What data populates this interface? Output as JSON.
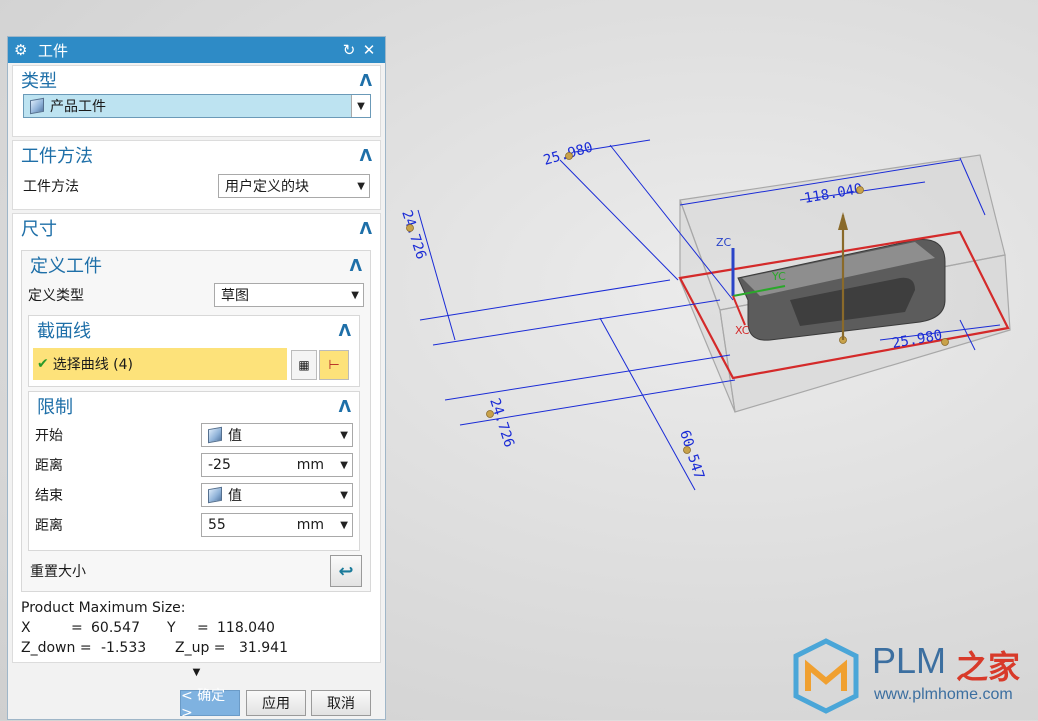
{
  "dialog": {
    "title": "工件",
    "reset_icon": "reset-icon",
    "close_icon": "close-icon"
  },
  "type_group": {
    "header": "类型",
    "selected": "产品工件"
  },
  "method_group": {
    "header": "工件方法",
    "label": "工件方法",
    "selected": "用户定义的块"
  },
  "size_group": {
    "header": "尺寸",
    "define_header": "定义工件",
    "define_type_label": "定义类型",
    "define_type_value": "草图",
    "section_header": "截面线",
    "select_curve_label": "选择曲线 (4)",
    "limit_header": "限制",
    "start_label": "开始",
    "start_value": "值",
    "distance1_label": "距离",
    "distance1_value": "-25",
    "distance1_unit": "mm",
    "end_label": "结束",
    "end_value": "值",
    "distance2_label": "距离",
    "distance2_value": "55",
    "distance2_unit": "mm",
    "resize_label": "重置大小"
  },
  "product_size": {
    "title": "Product Maximum Size:",
    "x_label": "X",
    "x_eq": "=",
    "x_value": "60.547",
    "y_label": "Y",
    "y_eq": "=",
    "y_value": "118.040",
    "zdown_label": "Z_down =",
    "zdown_value": "-1.533",
    "zup_label": "Z_up =",
    "zup_value": "31.941"
  },
  "footer": {
    "ok_label": "< 确定 >",
    "apply_label": "应用",
    "cancel_label": "取消"
  },
  "viewport": {
    "dim_top_left": "25.980",
    "dim_top": "118.040",
    "dim_left_upper": "24.726",
    "dim_left_lower": "24.726",
    "dim_right": "25.980",
    "dim_bottom": "60.547",
    "axis_zc": "ZC",
    "axis_yc": "YC",
    "axis_xc": "XC"
  },
  "watermark": {
    "brand": "PLM",
    "brand_cn": "之家",
    "url": "www.plmhome.com"
  },
  "colors": {
    "title_bar": "#2e8bc6",
    "section_header": "#1e6fa8",
    "highlight_row": "#fde27a",
    "dimension_blue": "#1a2bd6",
    "block_outline_red": "#d42a2a"
  }
}
